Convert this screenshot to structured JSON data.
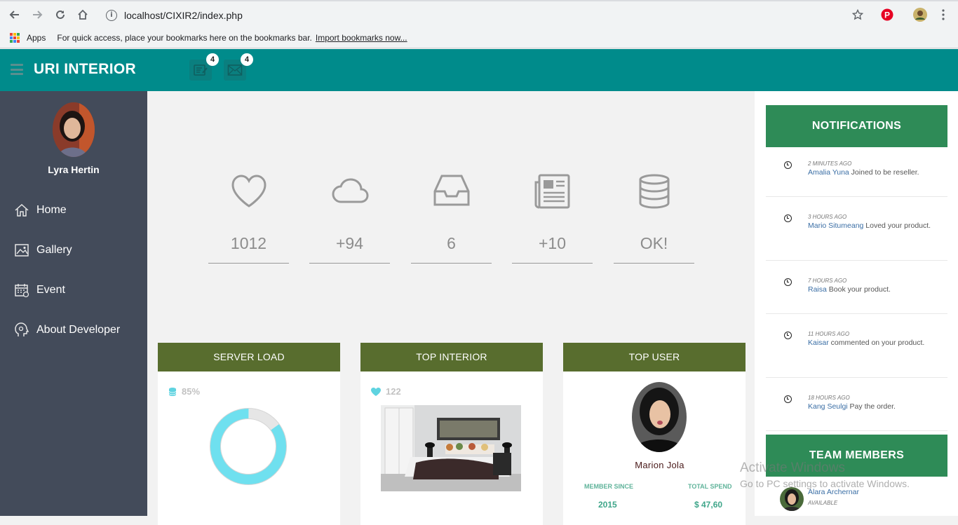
{
  "browser": {
    "url": "localhost/CIXIR2/index.php",
    "bookmarks_apps": "Apps",
    "bookmarks_hint": "For quick access, place your bookmarks here on the bookmarks bar.",
    "bookmarks_import": "Import bookmarks now..."
  },
  "header": {
    "brand": "URI INTERIOR",
    "tasks_badge": "4",
    "mail_badge": "4",
    "color": "#008b8b"
  },
  "sidebar": {
    "user_name": "Lyra Hertin",
    "items": [
      {
        "label": "Home",
        "icon": "home-icon"
      },
      {
        "label": "Gallery",
        "icon": "gallery-icon"
      },
      {
        "label": "Event",
        "icon": "calendar-icon"
      },
      {
        "label": "About Developer",
        "icon": "developer-icon"
      }
    ]
  },
  "stats": [
    {
      "icon": "heart-icon",
      "value": "1012"
    },
    {
      "icon": "cloud-icon",
      "value": "+94"
    },
    {
      "icon": "inbox-icon",
      "value": "6"
    },
    {
      "icon": "newspaper-icon",
      "value": "+10"
    },
    {
      "icon": "database-icon",
      "value": "OK!"
    }
  ],
  "cards": {
    "server_load": {
      "title": "SERVER LOAD",
      "value": "85%",
      "fraction": 0.85
    },
    "top_interior": {
      "title": "TOP INTERIOR",
      "likes": "122"
    },
    "top_user": {
      "title": "TOP USER",
      "name": "Marion Jola",
      "member_since_label": "MEMBER SINCE",
      "member_since": "2015",
      "total_spend_label": "TOTAL SPEND",
      "total_spend": "$ 47,60"
    }
  },
  "notifications": {
    "title": "NOTIFICATIONS",
    "items": [
      {
        "time": "2 MINUTES AGO",
        "name": "Amalia Yuna",
        "text": " Joined to be reseller."
      },
      {
        "time": "3 HOURS AGO",
        "name": "Mario Situmeang",
        "text": " Loved your product."
      },
      {
        "time": "7 HOURS AGO",
        "name": "Raisa",
        "text": " Book your product."
      },
      {
        "time": "11 HOURS AGO",
        "name": "Kaisar",
        "text": " commented on your product."
      },
      {
        "time": "18 HOURS AGO",
        "name": "Kang Seulgi",
        "text": " Pay the order."
      }
    ]
  },
  "team": {
    "title": "TEAM MEMBERS",
    "members": [
      {
        "name": "Alara Archernar",
        "status": "AVAILABLE"
      }
    ]
  },
  "watermark": {
    "line1": "Activate Windows",
    "line2": "Go to PC settings to activate Windows."
  }
}
